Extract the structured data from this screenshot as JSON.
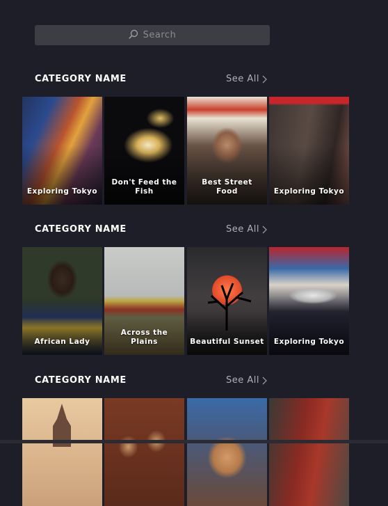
{
  "search": {
    "placeholder": "Search",
    "icon": "search-icon"
  },
  "see_all_label": "See All",
  "categories": [
    {
      "title": "CATEGORY NAME",
      "cards": [
        {
          "caption": "Exploring Tokyo"
        },
        {
          "caption": "Don't Feed the Fish"
        },
        {
          "caption": "Best Street Food"
        },
        {
          "caption": "Exploring Tokyo"
        }
      ]
    },
    {
      "title": "CATEGORY NAME",
      "cards": [
        {
          "caption": "African Lady"
        },
        {
          "caption": "Across the Plains"
        },
        {
          "caption": "Beautiful Sunset"
        },
        {
          "caption": "Exploring Tokyo"
        }
      ]
    },
    {
      "title": "CATEGORY NAME",
      "cards": [
        {
          "caption": ""
        },
        {
          "caption": ""
        },
        {
          "caption": ""
        },
        {
          "caption": ""
        }
      ]
    }
  ]
}
